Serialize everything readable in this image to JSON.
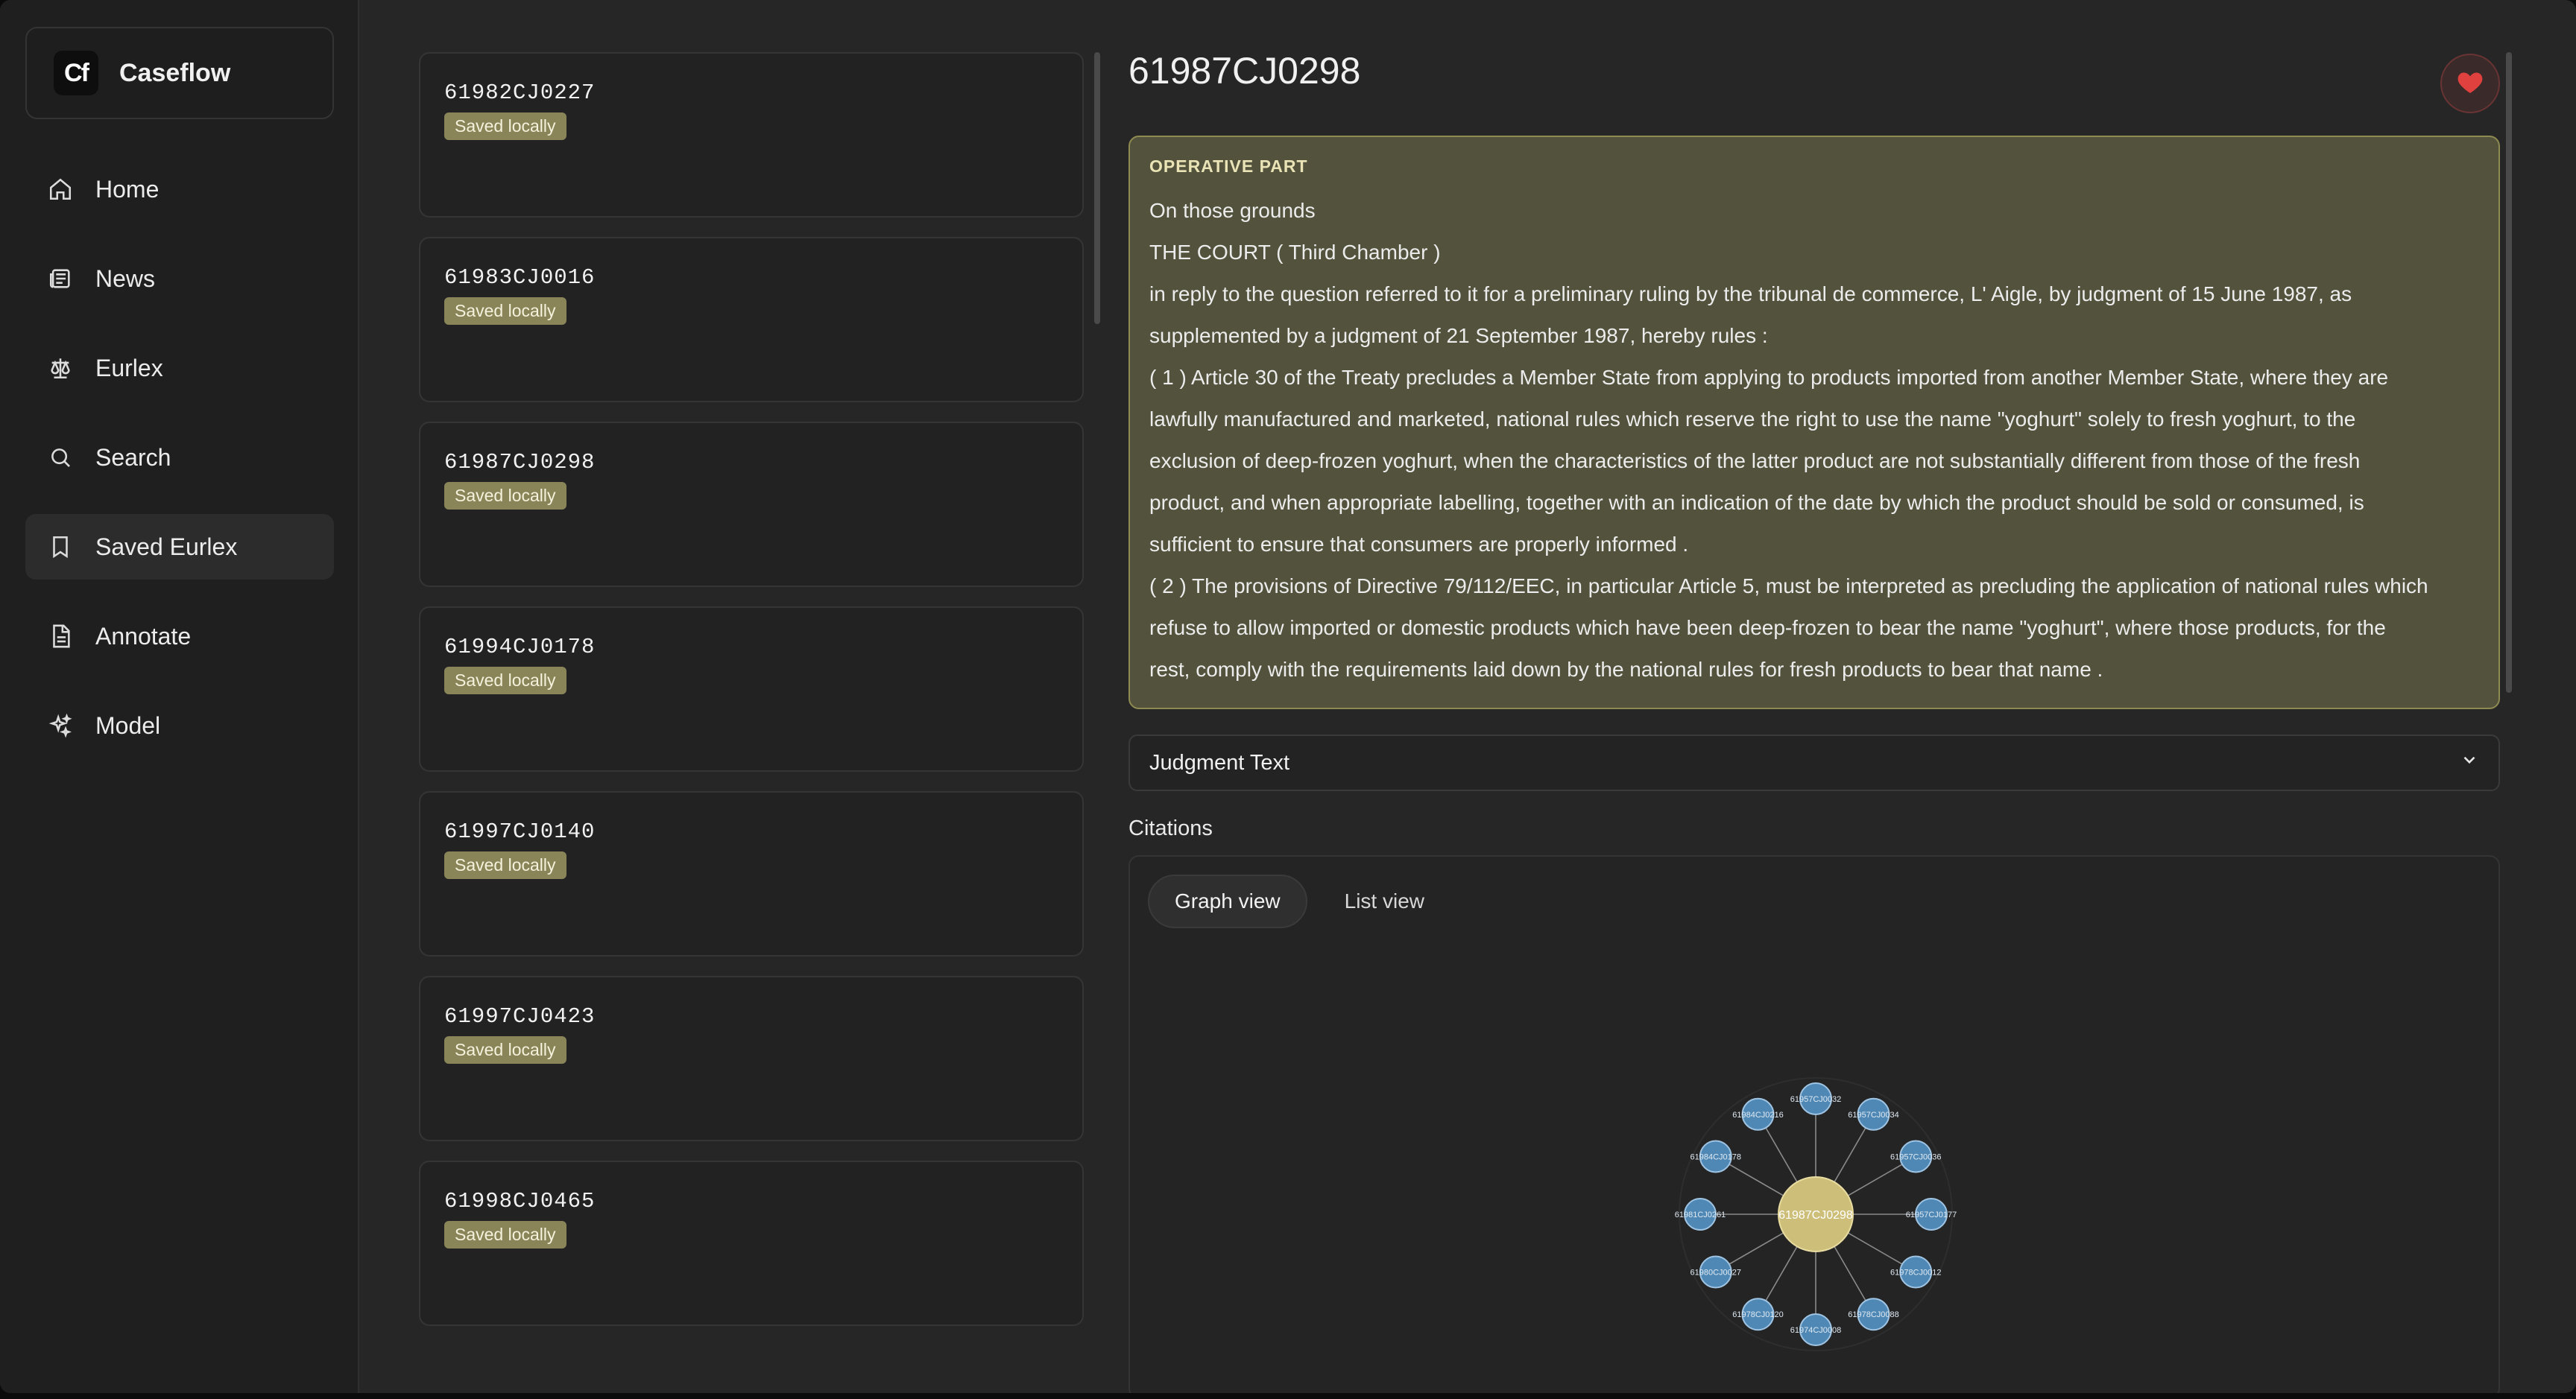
{
  "app": {
    "name": "Caseflow",
    "logo_text": "Cf"
  },
  "sidebar": {
    "items": [
      {
        "label": "Home",
        "icon": "home-icon"
      },
      {
        "label": "News",
        "icon": "newspaper-icon"
      },
      {
        "label": "Eurlex",
        "icon": "scale-icon"
      },
      {
        "label": "Search",
        "icon": "search-icon"
      },
      {
        "label": "Saved Eurlex",
        "icon": "bookmark-icon",
        "active": true
      },
      {
        "label": "Annotate",
        "icon": "document-icon"
      },
      {
        "label": "Model",
        "icon": "sparkles-icon"
      }
    ]
  },
  "cases": [
    {
      "id": "61982CJ0227",
      "badge": "Saved locally"
    },
    {
      "id": "61983CJ0016",
      "badge": "Saved locally"
    },
    {
      "id": "61987CJ0298",
      "badge": "Saved locally"
    },
    {
      "id": "61994CJ0178",
      "badge": "Saved locally"
    },
    {
      "id": "61997CJ0140",
      "badge": "Saved locally"
    },
    {
      "id": "61997CJ0423",
      "badge": "Saved locally"
    },
    {
      "id": "61998CJ0465",
      "badge": "Saved locally"
    }
  ],
  "detail": {
    "title": "61987CJ0298",
    "operative": {
      "heading": "OPERATIVE PART",
      "lines": [
        "On those grounds",
        "THE COURT ( Third Chamber )",
        "in reply to the question referred to it for a preliminary ruling by the tribunal de commerce, L' Aigle, by judgment of 15 June 1987, as",
        "supplemented by a judgment of 21 September 1987, hereby rules :",
        "( 1 ) Article 30 of the Treaty precludes a Member State from applying to products imported from another Member State, where they are",
        "lawfully manufactured and marketed, national rules which reserve the right to use the name \"yoghurt\" solely to fresh yoghurt, to the",
        "exclusion of deep-frozen yoghurt, when the characteristics of the latter product are not substantially different from those of the fresh",
        "product, and when appropriate labelling, together with an indication of the date by which the product should be sold or consumed, is",
        "sufficient to ensure that consumers are properly informed .",
        "( 2 ) The provisions of Directive 79/112/EEC, in particular Article 5, must be interpreted as precluding the application of national rules which",
        "refuse to allow imported or domestic products which have been deep-frozen to bear the name \"yoghurt\", where those products, for the",
        "rest, comply with the requirements laid down by the national rules for fresh products to bear that name ."
      ]
    },
    "judgment_select_label": "Judgment Text",
    "citations_label": "Citations",
    "tabs": [
      {
        "label": "Graph view",
        "active": true
      },
      {
        "label": "List view",
        "active": false
      }
    ],
    "graph": {
      "center": "61987CJ0298",
      "nodes": [
        "61957CJ0032",
        "61957CJ0034",
        "61957CJ0036",
        "61957CJ0177",
        "61978CJ0012",
        "61978CJ0088",
        "61974CJ0008",
        "61978CJ0120",
        "61980CJ0027",
        "61981CJ0261",
        "61984CJ0178",
        "61984CJ0216"
      ]
    }
  },
  "colors": {
    "accent_badge": "#8a8558",
    "operative_bg": "#53523c",
    "node_fill": "#4f88b5",
    "center_fill": "#cdbf7a",
    "heart": "#e0413f"
  }
}
